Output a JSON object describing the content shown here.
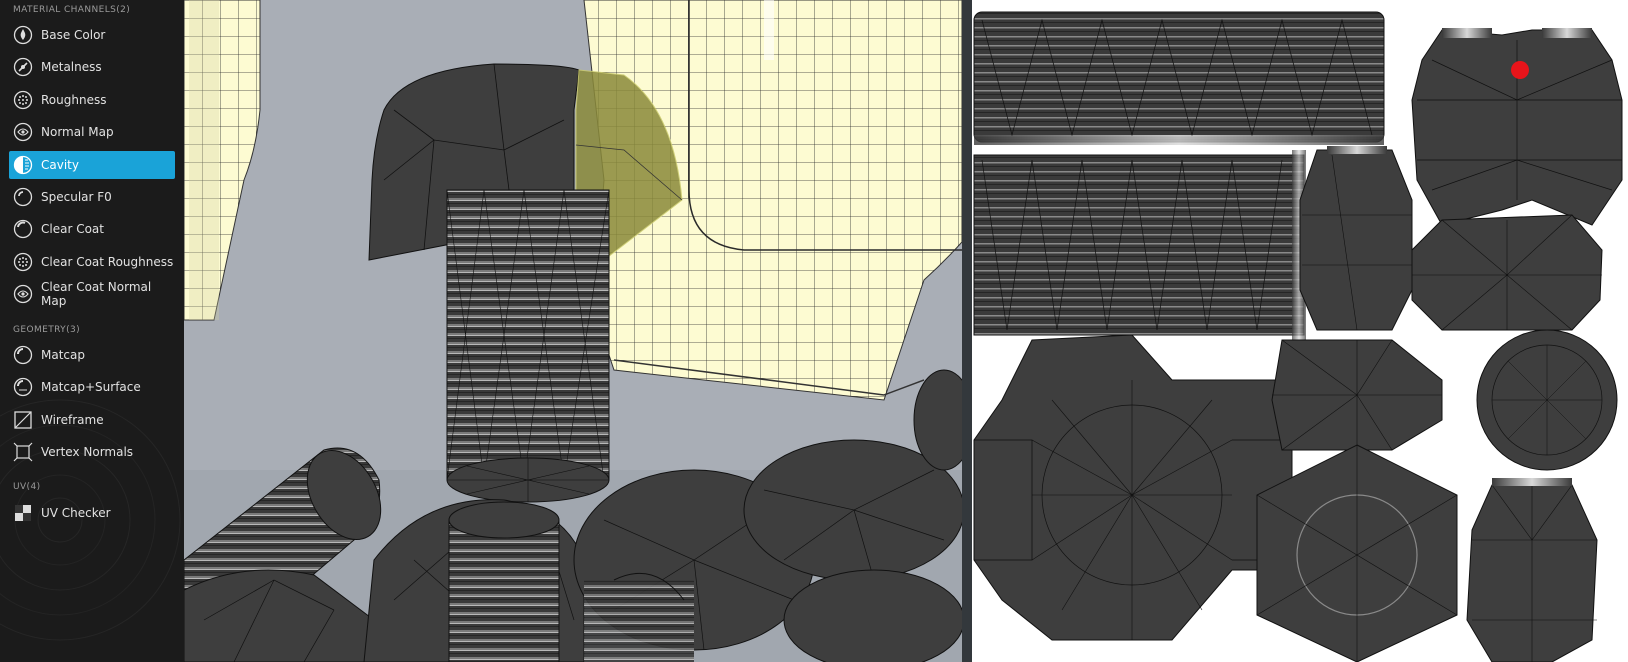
{
  "sidebar": {
    "sections": [
      {
        "title": "MATERIAL CHANNELS(2)",
        "items": [
          {
            "label": "Base Color",
            "icon": "droplet-icon",
            "active": false
          },
          {
            "label": "Metalness",
            "icon": "metal-icon",
            "active": false
          },
          {
            "label": "Roughness",
            "icon": "roughness-icon",
            "active": false
          },
          {
            "label": "Normal Map",
            "icon": "normal-map-icon",
            "active": false
          },
          {
            "label": "Cavity",
            "icon": "cavity-icon",
            "active": true
          },
          {
            "label": "Specular F0",
            "icon": "specular-icon",
            "active": false
          },
          {
            "label": "Clear Coat",
            "icon": "clear-coat-icon",
            "active": false
          },
          {
            "label": "Clear Coat Roughness",
            "icon": "roughness-icon",
            "active": false
          },
          {
            "label": "Clear Coat Normal Map",
            "icon": "normal-map-icon",
            "active": false
          }
        ]
      },
      {
        "title": "GEOMETRY(3)",
        "items": [
          {
            "label": "Matcap",
            "icon": "matcap-icon",
            "active": false
          },
          {
            "label": "Matcap+Surface",
            "icon": "matcap-surface-icon",
            "active": false
          },
          {
            "label": "Wireframe",
            "icon": "wireframe-icon",
            "active": false
          },
          {
            "label": "Vertex Normals",
            "icon": "vertex-normals-icon",
            "active": false
          }
        ]
      },
      {
        "title": "UV(4)",
        "items": [
          {
            "label": "UV Checker",
            "icon": "checker-icon",
            "active": false
          }
        ]
      }
    ]
  },
  "colors": {
    "accent": "#1aa3d8",
    "sidebar_bg": "#1b1b1b",
    "viewport_bg": "#a8adb5",
    "mesh_dark": "#3f3f3f",
    "mesh_light": "#fdfbd2",
    "selection": "#8a8a3a",
    "uv_bg": "#ffffff",
    "uv_marker": "#e8141a"
  }
}
